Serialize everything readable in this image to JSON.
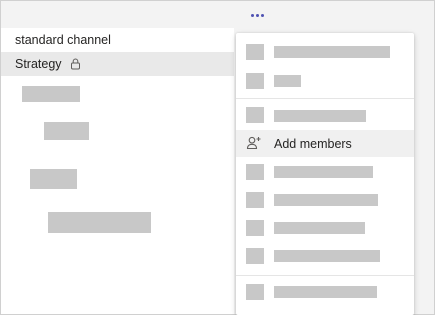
{
  "channels": {
    "items": [
      {
        "label": "standard channel"
      },
      {
        "label": "Strategy",
        "private": true
      }
    ]
  },
  "menu": {
    "more_options_icon": "more-horizontal-icon",
    "highlighted_item": {
      "label": "Add members",
      "icon": "add-person-icon"
    }
  },
  "colors": {
    "accent": "#4f52b2",
    "highlight": "#f0f0f0",
    "selected_channel": "#e9e9e9",
    "placeholder": "#c8c8c8"
  }
}
